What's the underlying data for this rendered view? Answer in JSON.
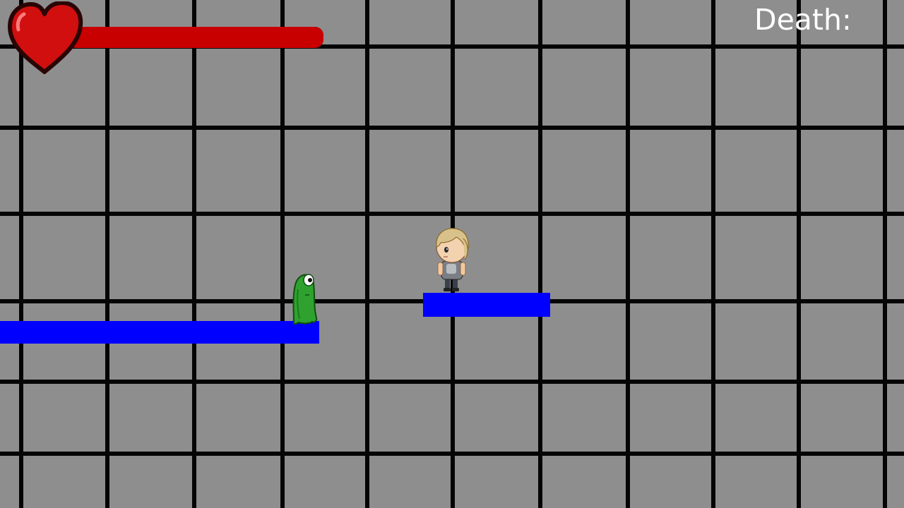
{
  "hud": {
    "death_label": "Death:",
    "death_count": "",
    "health_fraction": 1.0,
    "health_color": "#c80000",
    "heart_icon": "heart-icon"
  },
  "world": {
    "background_color": "#8e8e8e",
    "grid_color": "#050505",
    "platform_color": "#0000ff"
  },
  "entities": {
    "enemy": "green-slime-enemy",
    "player": "blonde-player-character"
  }
}
